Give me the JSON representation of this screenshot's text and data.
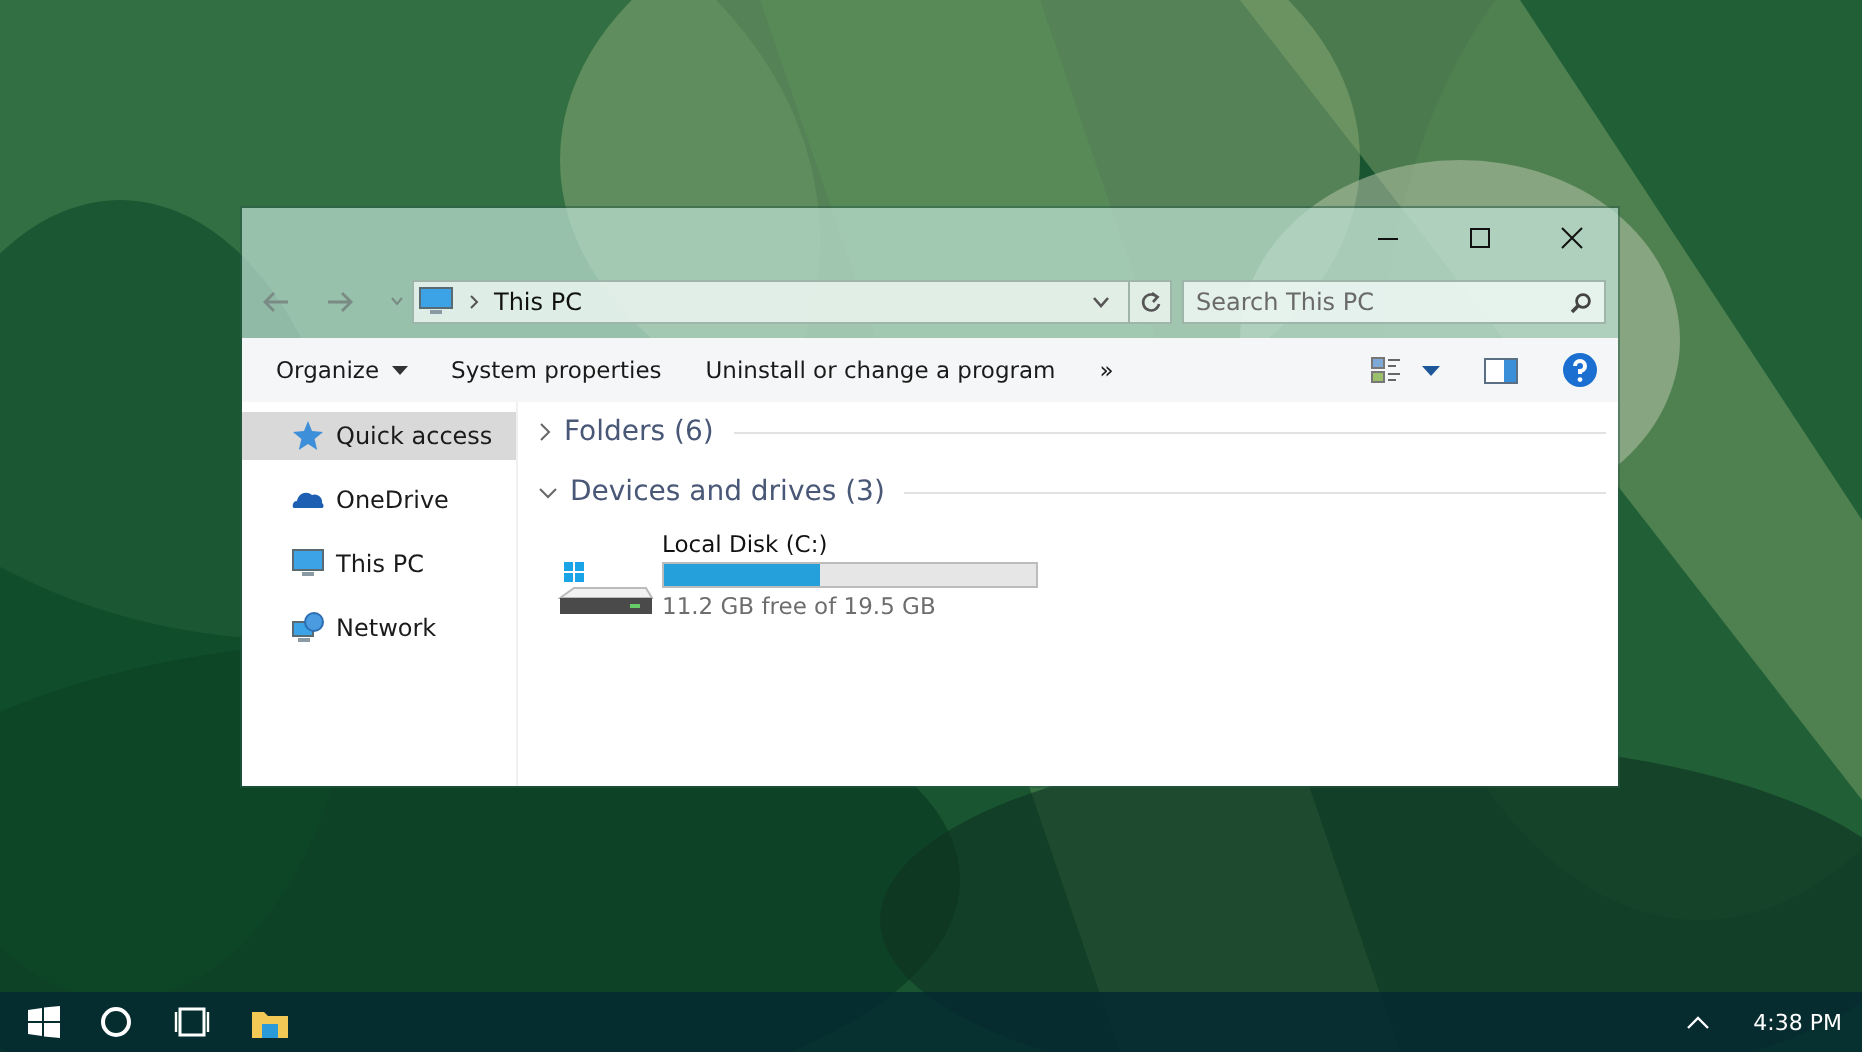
{
  "address": {
    "path": "This PC"
  },
  "search": {
    "placeholder": "Search This PC"
  },
  "toolbar": [
    {
      "label": "Organize",
      "kind": "menu"
    },
    {
      "label": "System properties",
      "kind": "action"
    },
    {
      "label": "Uninstall or change a program",
      "kind": "action"
    },
    {
      "label": "»",
      "kind": "action"
    }
  ],
  "sidebar": {
    "items": [
      {
        "label": "Quick access",
        "kind": "star",
        "selected": true
      },
      {
        "label": "OneDrive",
        "kind": "cloud",
        "selected": false
      },
      {
        "label": "This PC",
        "kind": "pc",
        "selected": false
      },
      {
        "label": "Network",
        "kind": "network",
        "selected": false
      }
    ]
  },
  "groups": [
    {
      "title": "Folders (6)",
      "expanded": false
    },
    {
      "title": "Devices and drives (3)",
      "expanded": true,
      "drives": [
        {
          "name": "Local Disk (C:)",
          "level": 0.42,
          "reading": "11.2 GB free of 19.5 GB"
        }
      ]
    }
  ],
  "taskbar": {
    "clock": "4:38 PM"
  }
}
